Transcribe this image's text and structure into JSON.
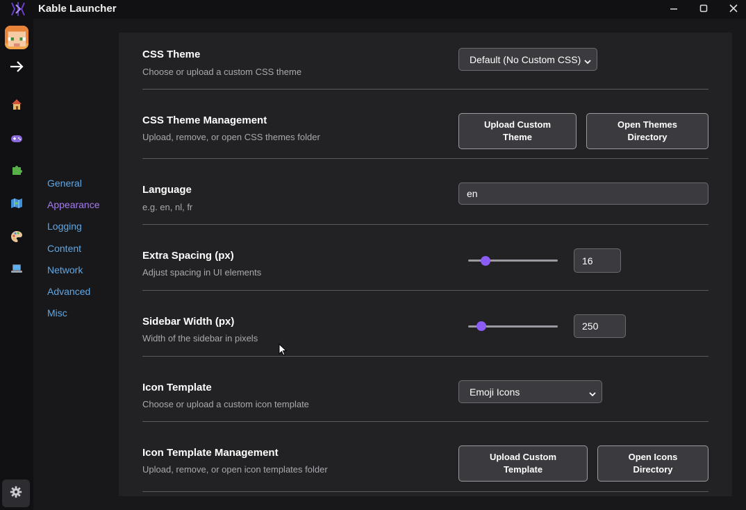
{
  "titlebar": {
    "app_title": "Kable Launcher",
    "logo_icon": "kable-logo-icon",
    "minimize_icon": "minimize-icon",
    "maximize_icon": "maximize-icon",
    "close_icon": "close-icon"
  },
  "rail": {
    "items": [
      {
        "name": "avatar",
        "icon": "player-avatar-icon"
      },
      {
        "name": "arrow-right",
        "icon": "arrow-right-icon"
      },
      {
        "name": "home",
        "icon": "house-emoji-icon"
      },
      {
        "name": "games",
        "icon": "gamepad-emoji-icon"
      },
      {
        "name": "mods",
        "icon": "puzzle-emoji-icon"
      },
      {
        "name": "maps",
        "icon": "map-emoji-icon"
      },
      {
        "name": "themes",
        "icon": "palette-emoji-icon"
      },
      {
        "name": "system",
        "icon": "laptop-emoji-icon"
      },
      {
        "name": "settings",
        "icon": "gear-icon"
      }
    ]
  },
  "subnav": {
    "items": [
      "General",
      "Appearance",
      "Logging",
      "Content",
      "Network",
      "Advanced",
      "Misc"
    ],
    "active": "Appearance"
  },
  "settings": {
    "css_theme": {
      "title": "CSS Theme",
      "desc": "Choose or upload a custom CSS theme",
      "selected": "Default (No Custom CSS)"
    },
    "css_theme_mgmt": {
      "title": "CSS Theme Management",
      "desc": "Upload, remove, or open CSS themes folder",
      "upload_label_1": "Upload Custom",
      "upload_label_2": "Theme",
      "open_label_1": "Open Themes",
      "open_label_2": "Directory"
    },
    "language": {
      "title": "Language",
      "desc": "e.g. en, nl, fr",
      "value": "en"
    },
    "extra_spacing": {
      "title": "Extra Spacing (px)",
      "desc": "Adjust spacing in UI elements",
      "value": "16",
      "slider_fraction": 0.16
    },
    "sidebar_width": {
      "title": "Sidebar Width (px)",
      "desc": "Width of the sidebar in pixels",
      "value": "250",
      "slider_fraction": 0.1
    },
    "icon_template": {
      "title": "Icon Template",
      "desc": "Choose or upload a custom icon template",
      "selected": "Emoji Icons"
    },
    "icon_template_mgmt": {
      "title": "Icon Template Management",
      "desc": "Upload, remove, or open icon templates folder",
      "upload_label_1": "Upload Custom",
      "upload_label_2": "Template",
      "open_label_1": "Open Icons",
      "open_label_2": "Directory"
    }
  },
  "colors": {
    "accent": "#8b5cf6",
    "link": "#5fa8e6",
    "active_link": "#a57bf0"
  }
}
